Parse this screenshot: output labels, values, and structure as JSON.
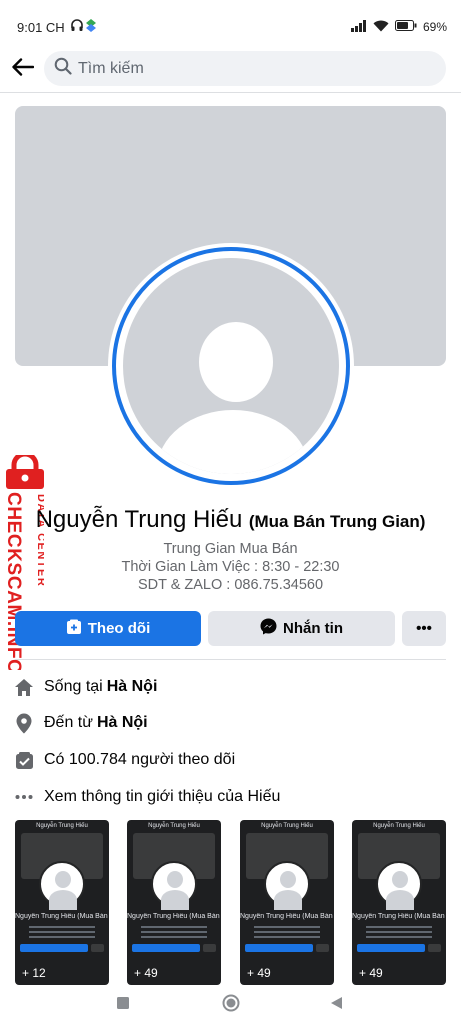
{
  "status_bar": {
    "time": "9:01 CH",
    "battery": "69"
  },
  "search": {
    "placeholder": "Tìm kiếm"
  },
  "watermark": {
    "line1": "DATA CENTER",
    "line2": "CHECKSCAM.INFO"
  },
  "profile": {
    "name": "Nguyễn Trung Hiếu",
    "name_suffix": "(Mua Bán Trung Gian)",
    "bio": [
      "Trung Gian Mua Bán",
      "Thời Gian Làm Việc : 8:30 - 22:30",
      "SDT & ZALO : 086.75.34560"
    ]
  },
  "actions": {
    "follow_label": "Theo dõi",
    "message_label": "Nhắn tin",
    "more_label": "•••"
  },
  "details": {
    "lives_in_prefix": "Sống tại",
    "lives_in_value": "Hà Nội",
    "from_prefix": "Đến từ",
    "from_value": "Hà Nội",
    "followers_text": "Có 100.784 người theo dõi",
    "about_text": "Xem thông tin giới thiệu của Hiếu"
  },
  "photos": [
    {
      "title": "Nguyễn Trung Hiếu",
      "name": "Nguyễn Trung Hiếu (Mua Bán Trung Gian)",
      "count": "+ 12"
    },
    {
      "title": "Nguyễn Trung Hiếu",
      "name": "Nguyễn Trung Hiếu (Mua Bán Trung Gian)",
      "count": "+ 49"
    },
    {
      "title": "Nguyễn Trung Hiếu",
      "name": "Nguyễn Trung Hiếu (Mua Bán Trung Gian)",
      "count": "+ 49"
    },
    {
      "title": "Nguyễn Trung Hiếu",
      "name": "Nguyễn Trung Hiếu (Mua Bán Trung Gian)",
      "count": "+ 49"
    }
  ],
  "colors": {
    "accent": "#1b74e4",
    "watermark": "#e02020",
    "cover": "#d0d3d8"
  }
}
